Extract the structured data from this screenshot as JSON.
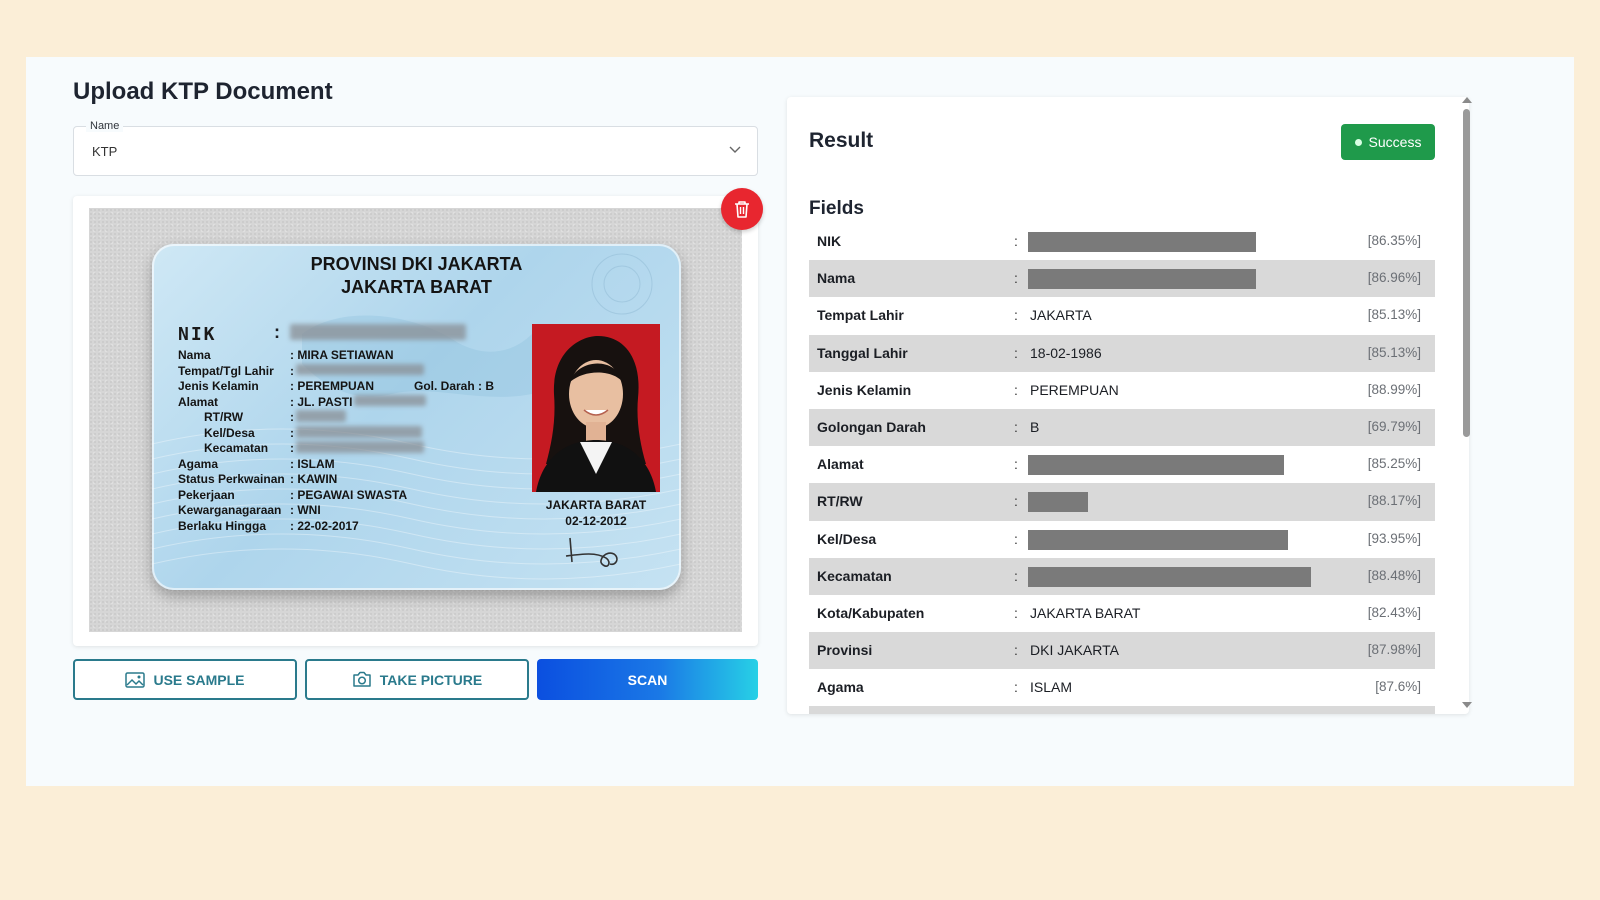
{
  "upload": {
    "title": "Upload KTP Document",
    "select": {
      "label": "Name",
      "value": "KTP"
    }
  },
  "ktp_card": {
    "province": "PROVINSI DKI JAKARTA",
    "city": "JAKARTA BARAT",
    "nik_label": "NIK",
    "rows": [
      {
        "label": "Nama",
        "value": ": MIRA SETIAWAN"
      },
      {
        "label": "Tempat/Tgl Lahir",
        "value": ":"
      },
      {
        "label": "Jenis Kelamin",
        "value": ": PEREMPUAN"
      },
      {
        "label": "Alamat",
        "value": ": JL. PASTI"
      },
      {
        "label": "RT/RW",
        "value": ":"
      },
      {
        "label": "Kel/Desa",
        "value": ":"
      },
      {
        "label": "Kecamatan",
        "value": ":"
      },
      {
        "label": "Agama",
        "value": ": ISLAM"
      },
      {
        "label": "Status Perkwainan",
        "value": ": KAWIN"
      },
      {
        "label": "Pekerjaan",
        "value": ": PEGAWAI SWASTA"
      },
      {
        "label": "Kewarganagaraan",
        "value": ": WNI"
      },
      {
        "label": "Berlaku Hingga",
        "value": ": 22-02-2017"
      }
    ],
    "blood_type": "Gol. Darah : B",
    "issue_city": "JAKARTA BARAT",
    "issue_date": "02-12-2012"
  },
  "actions": {
    "delete_icon": "trash-icon",
    "use_sample": "USE SAMPLE",
    "take_picture": "TAKE PICTURE",
    "scan": "SCAN"
  },
  "result": {
    "title": "Result",
    "status": "Success",
    "status_color": "#1f9a4b",
    "fields_title": "Fields",
    "fields": [
      {
        "label": "NIK",
        "value": "",
        "redacted": true,
        "confidence": "[86.35%]"
      },
      {
        "label": "Nama",
        "value": "",
        "redacted": true,
        "confidence": "[86.96%]"
      },
      {
        "label": "Tempat Lahir",
        "value": "JAKARTA",
        "redacted": false,
        "confidence": "[85.13%]"
      },
      {
        "label": "Tanggal Lahir",
        "value": "18-02-1986",
        "redacted": false,
        "confidence": "[85.13%]"
      },
      {
        "label": "Jenis Kelamin",
        "value": "PEREMPUAN",
        "redacted": false,
        "confidence": "[88.99%]"
      },
      {
        "label": "Golongan Darah",
        "value": "B",
        "redacted": false,
        "confidence": "[69.79%]"
      },
      {
        "label": "Alamat",
        "value": "",
        "redacted": true,
        "confidence": "[85.25%]"
      },
      {
        "label": "RT/RW",
        "value": "",
        "redacted": true,
        "confidence": "[88.17%]"
      },
      {
        "label": "Kel/Desa",
        "value": "",
        "redacted": true,
        "confidence": "[93.95%]"
      },
      {
        "label": "Kecamatan",
        "value": "",
        "redacted": true,
        "confidence": "[88.48%]"
      },
      {
        "label": "Kota/Kabupaten",
        "value": "JAKARTA BARAT",
        "redacted": false,
        "confidence": "[82.43%]"
      },
      {
        "label": "Provinsi",
        "value": "DKI JAKARTA",
        "redacted": false,
        "confidence": "[87.98%]"
      },
      {
        "label": "Agama",
        "value": "ISLAM",
        "redacted": false,
        "confidence": "[87.6%]"
      }
    ]
  }
}
